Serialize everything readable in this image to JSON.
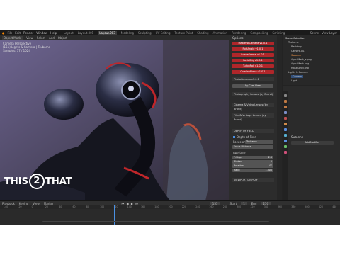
{
  "menu": {
    "items": [
      "File",
      "Edit",
      "Render",
      "Window",
      "Help"
    ]
  },
  "workspaces": {
    "tabs": [
      "Layout",
      "Layout.001",
      "Layout.003",
      "Modeling",
      "Sculpting",
      "UV Editing",
      "Texture Paint",
      "Shading",
      "Animation",
      "Rendering",
      "Compositing",
      "Scripting"
    ],
    "active": "Layout.003"
  },
  "viewport": {
    "header": [
      "Object Mode",
      "View",
      "Select",
      "Add",
      "Object"
    ],
    "overlay": [
      "Camera Perspective",
      "(151) Lights & Camera | Tsubame",
      "Samples: 37 / 1024"
    ]
  },
  "scene": {
    "label": "Scene",
    "view_layer": "View Layer"
  },
  "npanel": {
    "title": "Options",
    "red_buttons": [
      "MasterstCamera v1.0.1",
      "PortAngle v1.0.1",
      "SceneFrame v1.0.1",
      "FacialRig v1.0.1",
      "TurboRoll v1.0.1",
      "OverlayPlane v1.0.1"
    ],
    "section_title": "PhotoCamera v1.0.1",
    "bycam": "By Cam View",
    "lenses": [
      "Photography Lenses (by Brand)",
      "Cinema & Video Lenses (by Brand)",
      "Film & Vintage Lenses (by Brand)"
    ],
    "dof_header": "DEPTH OF FIELD",
    "dof_check": "Depth of Field",
    "focus_label": "Focus on",
    "focus_value": "Tsubame",
    "focus_dist": "Focus Distance",
    "aperture": "Aperture",
    "rows": [
      {
        "label": "F-Stop",
        "value": "2.8"
      },
      {
        "label": "Blades",
        "value": "0"
      },
      {
        "label": "Rotation",
        "value": "0°"
      },
      {
        "label": "Ratio",
        "value": "1.000"
      }
    ],
    "viewport_display": "VIEWPORT DISPLAY"
  },
  "outliner": {
    "title": "Scene Collection",
    "rows": [
      "Scene Collection",
      "Tsubame",
      "Backdrop",
      "Camera.001",
      "Suzanne",
      "AlphaMask_a.png",
      "AlphaMask.png",
      "MaskSpray.png",
      "Lights & Camera",
      "Camera",
      "Light"
    ]
  },
  "properties": {
    "object": "Suzanne",
    "modifier": "Add Modifier"
  },
  "timeline": {
    "header": [
      "Playback",
      "Keying",
      "View",
      "Marker"
    ],
    "ruler": [
      "-40",
      "-20",
      "0",
      "20",
      "40",
      "60",
      "80",
      "100",
      "120",
      "140",
      "160",
      "180",
      "200",
      "220",
      "240",
      "260",
      "280",
      "300",
      "320",
      "340",
      "360",
      "380",
      "400",
      "420",
      "440"
    ],
    "current_frame": "155",
    "start": "Start",
    "start_val": "1",
    "end": "End",
    "end_val": "250"
  },
  "logo": {
    "left": "THIS",
    "mid": "2",
    "right": "THAT"
  },
  "colors": {
    "accent": "#b0262a",
    "outline_orange": "#ff7a2c"
  }
}
